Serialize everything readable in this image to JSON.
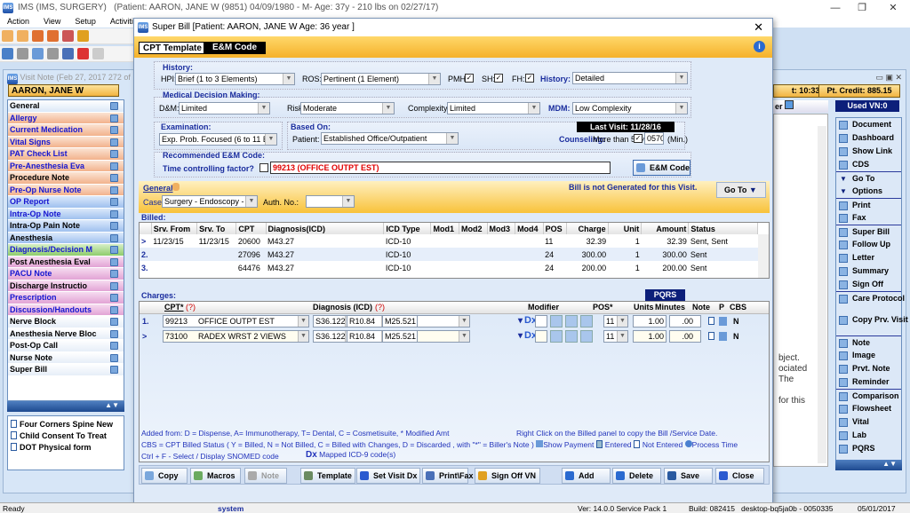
{
  "app": {
    "title": "IMS (IMS, SURGERY)",
    "patient_header": "(Patient: AARON, JANE W (9851) 04/09/1980 - M- Age: 37y  - 210 lbs on 02/27/17)",
    "logo_text": "IMS"
  },
  "menu": [
    "Action",
    "View",
    "Setup",
    "Activities"
  ],
  "visit_note": {
    "title": "Visit Note (Feb 27, 2017   272 of",
    "patient": "AARON, JANE W",
    "time": "t: 10:33 A",
    "credit": "Pt. Credit: 885.15",
    "used_vn": "Used VN:0",
    "partial_header": "er",
    "bg_lines": [
      "bject.",
      "ociated",
      " The",
      "for this"
    ]
  },
  "sidebar": [
    {
      "label": "General",
      "c": "c-gen",
      "blue": false
    },
    {
      "label": "Allergy",
      "c": "c-or",
      "blue": true
    },
    {
      "label": "Current Medication",
      "c": "c-or",
      "blue": true
    },
    {
      "label": "Vital Signs",
      "c": "c-or",
      "blue": true
    },
    {
      "label": "PAT Check List",
      "c": "c-or",
      "blue": true
    },
    {
      "label": "Pre-Anesthesia Eva",
      "c": "c-or",
      "blue": true
    },
    {
      "label": "Procedure Note",
      "c": "c-or",
      "blue": false
    },
    {
      "label": "Pre-Op Nurse Note",
      "c": "c-or",
      "blue": true
    },
    {
      "label": "OP Report",
      "c": "c-bl",
      "blue": true
    },
    {
      "label": "Intra-Op Note",
      "c": "c-bl",
      "blue": true
    },
    {
      "label": "Intra-Op Pain Note",
      "c": "c-bl",
      "blue": false
    },
    {
      "label": "Anesthesia",
      "c": "c-bl",
      "blue": false
    },
    {
      "label": "Diagnosis/Decision M",
      "c": "c-gr",
      "blue": true
    },
    {
      "label": "Post Anesthesia Eval",
      "c": "c-pk",
      "blue": false
    },
    {
      "label": "PACU Note",
      "c": "c-pk",
      "blue": true
    },
    {
      "label": "Discharge Instructio",
      "c": "c-pk",
      "blue": false
    },
    {
      "label": "Prescription",
      "c": "c-pk",
      "blue": true
    },
    {
      "label": "Discussion/Handouts",
      "c": "c-pk",
      "blue": true
    },
    {
      "label": "Nerve Block",
      "c": "c-wh",
      "blue": false
    },
    {
      "label": "Anesthesia Nerve Bloc",
      "c": "c-wh",
      "blue": false
    },
    {
      "label": "Post-Op Call",
      "c": "c-wh",
      "blue": false
    },
    {
      "label": "Nurse Note",
      "c": "c-wh",
      "blue": false
    },
    {
      "label": "Super Bill",
      "c": "c-wh",
      "blue": false
    }
  ],
  "forms": [
    "Four Corners Spine New",
    "Child Consent To Treat",
    "DOT Physical form"
  ],
  "right_panel": [
    {
      "label": "Document",
      "icon": "document-icon",
      "sep": false
    },
    {
      "label": "Dashboard",
      "icon": "dashboard-icon",
      "sep": false
    },
    {
      "label": "Show Link",
      "icon": "link-icon",
      "sep": false
    },
    {
      "label": "CDS",
      "icon": "cds-icon",
      "sep": false
    },
    {
      "label": "Go To",
      "icon": "triangle-down-icon",
      "sep": true
    },
    {
      "label": "Options",
      "icon": "triangle-down-icon",
      "sep": false
    },
    {
      "label": "Print",
      "icon": "print-icon",
      "sep": true
    },
    {
      "label": "Fax",
      "icon": "fax-icon",
      "sep": false
    },
    {
      "label": "Super Bill",
      "icon": "super-bill-icon",
      "sep": true
    },
    {
      "label": "Follow Up",
      "icon": "calendar-icon",
      "sep": false
    },
    {
      "label": "Letter",
      "icon": "letter-icon",
      "sep": false
    },
    {
      "label": "Summary",
      "icon": "summary-icon",
      "sep": false
    },
    {
      "label": "Sign Off",
      "icon": "sign-off-icon",
      "sep": false
    },
    {
      "label": "Care Protocol",
      "icon": "care-protocol-icon",
      "sep": true,
      "two": true
    },
    {
      "label": "Copy Prv. Visit",
      "icon": "copy-icon",
      "sep": false,
      "two": true
    },
    {
      "label": "Note",
      "icon": "note-icon",
      "sep": true
    },
    {
      "label": "Image",
      "icon": "image-icon",
      "sep": false
    },
    {
      "label": "Prvt. Note",
      "icon": "private-note-icon",
      "sep": false
    },
    {
      "label": "Reminder",
      "icon": "reminder-icon",
      "sep": false
    },
    {
      "label": "Comparison",
      "icon": "checklist-icon",
      "sep": true
    },
    {
      "label": "Flowsheet",
      "icon": "checklist-icon",
      "sep": false
    },
    {
      "label": "Vital",
      "icon": "checklist-icon",
      "sep": false
    },
    {
      "label": "Lab",
      "icon": "checklist-icon",
      "sep": false
    },
    {
      "label": "PQRS",
      "icon": "checklist-icon",
      "sep": false
    }
  ],
  "dialog": {
    "title": "Super Bill  [Patient: AARON, JANE W  Age: 36 year ]",
    "tabs": [
      "CPT Template",
      "E&M Code"
    ],
    "history": {
      "header": "History:",
      "hpi_label": "HPI:",
      "hpi": "Brief (1 to 3 Elements)",
      "ros_label": "ROS:",
      "ros": "Pertinent (1 Element)",
      "pmh": "PMH:",
      "sh": "SH:",
      "fh": "FH:",
      "history_label": "History:",
      "history": "Detailed"
    },
    "mdm": {
      "header": "Medical Decision Making:",
      "dm_label": "D&M:",
      "dm": "Limited",
      "risk_label": "Risk:",
      "risk": "Moderate",
      "complexity_label": "Complexity:",
      "complexity": "Limited",
      "mdm_label": "MDM:",
      "mdm": "Low Complexity"
    },
    "exam": {
      "header": "Examination:",
      "value": "Exp. Prob. Focused (6 to 11 Ele"
    },
    "based_on": {
      "header": "Based On:",
      "patient_label": "Patient:",
      "patient": "Established Office/Outpatient"
    },
    "last_visit": "Last Visit: 11/28/16",
    "counseling": {
      "label": "Counseling:",
      "text": "More than 50%:",
      "minutes": "0570",
      "unit": "(Min.)"
    },
    "recommended": {
      "header": "Recommended E&M Code:",
      "time_label": "Time controlling factor?",
      "code": "99213  (OFFICE OUTPT EST)",
      "button": "E&M Code"
    },
    "general": {
      "label": "General",
      "case_label": "Case*",
      "case": "Surgery - Endoscopy  -  0001",
      "auth_label": "Auth. No.:",
      "auth": "",
      "bill_status": "Bill is not Generated for this Visit.",
      "goto": "Go To"
    },
    "billed": {
      "label": "Billed:",
      "columns": [
        "",
        "Srv. From",
        "Srv. To",
        "CPT",
        "Diagnosis(ICD)",
        "ICD Type",
        "Mod1",
        "Mod2",
        "Mod3",
        "Mod4",
        "POS",
        "Charge",
        "Unit",
        "Amount",
        "Status"
      ],
      "rows": [
        [
          ">",
          "11/23/15",
          "11/23/15",
          "20600",
          "M43.27",
          "ICD-10",
          "",
          "",
          "",
          "",
          "11",
          "32.39",
          "1",
          "32.39",
          "Sent, Sent"
        ],
        [
          "2.",
          "",
          "",
          "27096",
          "M43.27",
          "ICD-10",
          "",
          "",
          "",
          "",
          "24",
          "300.00",
          "1",
          "300.00",
          "Sent"
        ],
        [
          "3.",
          "",
          "",
          "64476",
          "M43.27",
          "ICD-10",
          "",
          "",
          "",
          "",
          "24",
          "200.00",
          "1",
          "200.00",
          "Sent"
        ]
      ]
    },
    "charges": {
      "label": "Charges:",
      "pqrs": "PQRS",
      "columns": {
        "cpt": "CPT*",
        "q": "(?)",
        "diag": "Diagnosis (ICD)",
        "mod": "Modifier",
        "pos": "POS*",
        "units": "Units",
        "minutes": "Minutes",
        "note": "Note",
        "p": "P",
        "cbs": "CBS"
      },
      "rows": [
        {
          "num": "1.",
          "cpt": "99213",
          "desc": "OFFICE OUTPT EST",
          "d1": "S36.122S",
          "d2": "R10.84",
          "d3": "M25.521",
          "d4": "",
          "pos": "11",
          "units": "1.00",
          "minutes": ".00",
          "cbs": "N",
          "dx": "Dx"
        },
        {
          "num": ">",
          "cpt": "73100",
          "desc": "RADEX WRST 2 VIEWS",
          "d1": "S36.122S",
          "d2": "R10.84",
          "d3": "M25.521",
          "d4": "",
          "pos": "11",
          "units": "1.00",
          "minutes": ".00",
          "cbs": "N",
          "dx": "Dx"
        }
      ]
    },
    "legend": {
      "line1": "Added from: D = Dispense, A= Immunotherapy, T= Dental,  C = Cosmetisuite,   * Modified Amt",
      "copy_hint": "Right Click on the Billed panel to copy the Bill /Service Date.",
      "line2": "CBS = CPT Billed Status ( Y = Billed, N = Not Billed, C = Billed with Changes, D = Discarded , with \"*\" = Biller's Note )",
      "show_payment": "Show Payment",
      "entered": "Entered",
      "not_entered": "Not Entered",
      "process_time": "Process Time",
      "line3": "Ctrl + F - Select / Display SNOMED code",
      "dx": "Dx",
      "mapped": "Mapped ICD-9 code(s)"
    },
    "buttons": [
      "Copy",
      "Macros",
      "Note",
      "Template",
      "Set Visit Dx",
      "Print\\Fax",
      "Sign Off VN",
      "Add",
      "Delete",
      "Save",
      "Close"
    ]
  },
  "status": {
    "ready": "Ready",
    "user": "system",
    "version": "Ver: 14.0.0 Service Pack 1",
    "build": "Build: 082415",
    "machine": "desktop-bq5ja0b - 0050335",
    "date": "05/01/2017"
  },
  "colors": {
    "accent_blue": "#1a2d9e",
    "highlight_red": "#e00000",
    "tab_orange": "#f5b12a"
  }
}
